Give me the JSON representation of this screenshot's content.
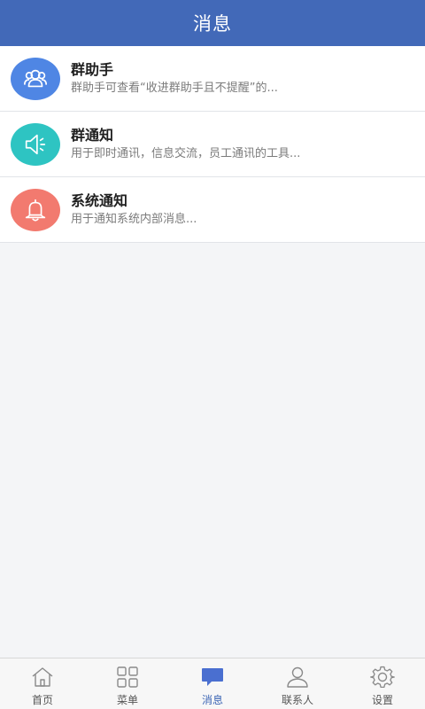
{
  "header": {
    "title": "消息"
  },
  "messages": [
    {
      "title": "群助手",
      "desc": "群助手可查看“收进群助手且不提醒”的...",
      "icon": "group-people-icon",
      "color": "#4f86e4"
    },
    {
      "title": "群通知",
      "desc": "用于即时通讯，信息交流，员工通讯的工具...",
      "icon": "speaker-icon",
      "color": "#2ec4c2"
    },
    {
      "title": "系统通知",
      "desc": "用于通知系统内部消息...",
      "icon": "bell-icon",
      "color": "#f27a6f"
    }
  ],
  "tabs": [
    {
      "label": "首页",
      "icon": "home-icon",
      "active": false
    },
    {
      "label": "菜单",
      "icon": "grid-menu-icon",
      "active": false
    },
    {
      "label": "消息",
      "icon": "chat-bubble-icon",
      "active": true
    },
    {
      "label": "联系人",
      "icon": "person-icon",
      "active": false
    },
    {
      "label": "设置",
      "icon": "gear-icon",
      "active": false
    }
  ],
  "colors": {
    "header": "#4269b8",
    "active_tab": "#3c66b5"
  }
}
